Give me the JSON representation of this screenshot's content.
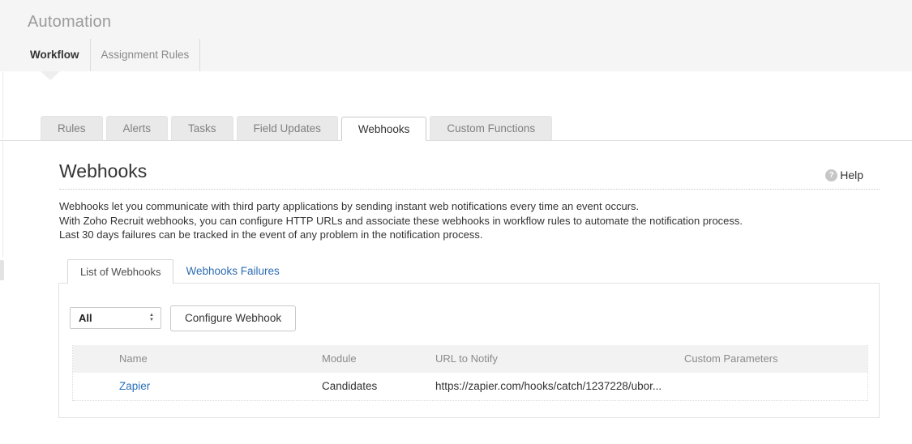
{
  "header": {
    "title": "Automation",
    "tabs": [
      {
        "label": "Workflow"
      },
      {
        "label": "Assignment Rules"
      }
    ]
  },
  "workflow_tabs": {
    "items": [
      {
        "label": "Rules"
      },
      {
        "label": "Alerts"
      },
      {
        "label": "Tasks"
      },
      {
        "label": "Field Updates"
      },
      {
        "label": "Webhooks"
      },
      {
        "label": "Custom Functions"
      }
    ],
    "active": "Webhooks"
  },
  "page": {
    "title": "Webhooks",
    "help": {
      "label": "Help",
      "icon": "?"
    },
    "description_lines": [
      "Webhooks let you communicate with third party applications by sending instant web notifications every time an event occurs.",
      "With Zoho Recruit webhooks, you can configure HTTP URLs and associate these webhooks in workflow rules to automate the notification process.",
      "Last 30 days failures can be tracked in the event of any problem in the notification process."
    ]
  },
  "webhooks_panel": {
    "tabs": [
      {
        "label": "List of Webhooks"
      },
      {
        "label": "Webhooks Failures"
      }
    ],
    "module_filter": {
      "value": "All"
    },
    "icons": {
      "arrow_up": "▲",
      "arrow_down": "▼"
    },
    "configure_button_label": "Configure Webhook",
    "table": {
      "columns": [
        "Name",
        "Module",
        "URL to Notify",
        "Custom Parameters"
      ],
      "rows": [
        {
          "name": "Zapier",
          "module": "Candidates",
          "url": "https://zapier.com/hooks/catch/1237228/ubor...",
          "custom_parameters": ""
        }
      ]
    }
  },
  "colors": {
    "link_blue": "#2a70b8",
    "panel_link_blue": "#2d6cb2",
    "header_bg": "#f5f5f6",
    "inactive_tab_bg": "#e9e9e9",
    "table_header_bg": "#f2f2f2",
    "muted_text": "#8b8b8b"
  }
}
